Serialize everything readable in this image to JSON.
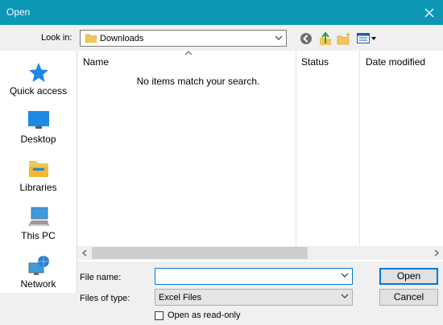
{
  "window": {
    "title": "Open",
    "close_glyph": "✕"
  },
  "lookin": {
    "label": "Look in:",
    "value": "Downloads"
  },
  "toolbar": {
    "icons": [
      "back-icon",
      "up-folder-icon",
      "new-folder-icon",
      "view-menu-icon"
    ]
  },
  "places": [
    {
      "label": "Quick access",
      "icon": "star-icon"
    },
    {
      "label": "Desktop",
      "icon": "desktop-icon"
    },
    {
      "label": "Libraries",
      "icon": "libraries-icon"
    },
    {
      "label": "This PC",
      "icon": "computer-icon"
    },
    {
      "label": "Network",
      "icon": "network-icon"
    }
  ],
  "filelist": {
    "columns": [
      "Name",
      "Status",
      "Date modified"
    ],
    "empty_message": "No items match your search."
  },
  "form": {
    "filename_label": "File name:",
    "filename_value": "",
    "filetype_label": "Files of type:",
    "filetype_value": "Excel Files",
    "readonly_label": "Open as read-only",
    "readonly_checked": false
  },
  "buttons": {
    "open": "Open",
    "cancel": "Cancel"
  },
  "colors": {
    "titlebar": "#0c97b4",
    "accent": "#0078d7"
  }
}
